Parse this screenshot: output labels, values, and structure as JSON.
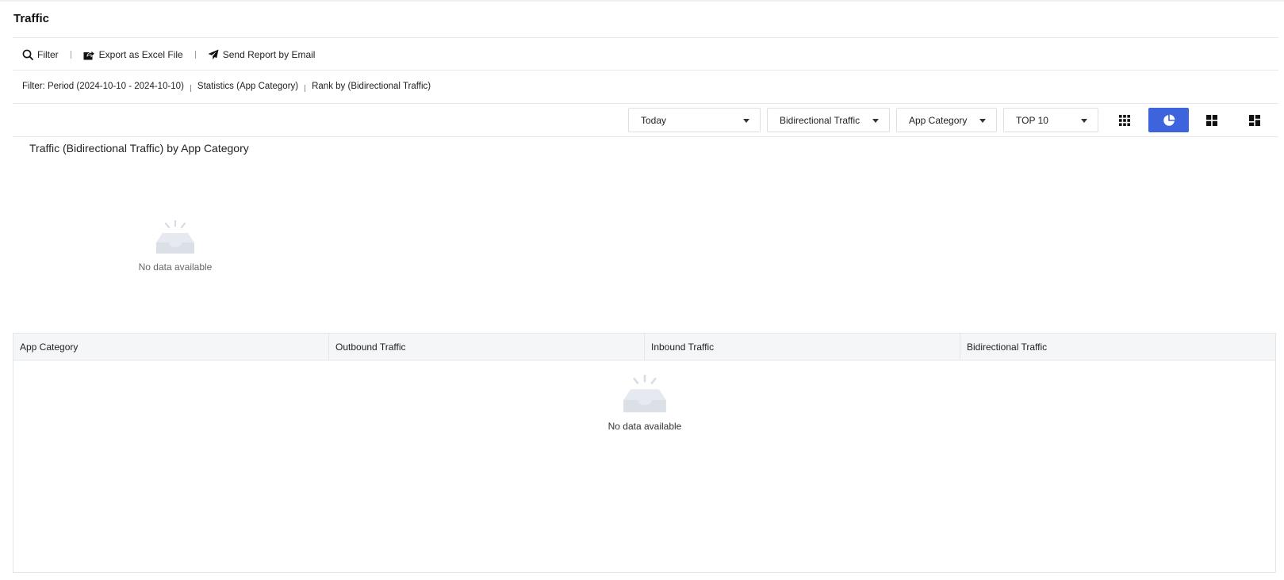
{
  "page": {
    "title": "Traffic"
  },
  "toolbar": {
    "filter_label": "Filter",
    "export_label": "Export as Excel File",
    "email_label": "Send Report by Email"
  },
  "filter_summary": {
    "period": "Filter: Period (2024-10-10 - 2024-10-10)",
    "statistics": "Statistics (App Category)",
    "rank": "Rank by (Bidirectional Traffic)"
  },
  "controls": {
    "period_select": "Today",
    "metric_select": "Bidirectional Traffic",
    "group_select": "App Category",
    "top_select": "TOP 10",
    "view_modes": [
      "grid-view",
      "pie-chart-view",
      "tile-view",
      "dashboard-view"
    ],
    "active_view": "pie-chart-view",
    "accent_color": "#3d63dd"
  },
  "chart": {
    "title": "Traffic (Bidirectional Traffic) by App Category",
    "empty_text": "No data available"
  },
  "table": {
    "columns": [
      "App Category",
      "Outbound Traffic",
      "Inbound Traffic",
      "Bidirectional Traffic"
    ],
    "rows": [],
    "empty_text": "No data available"
  }
}
